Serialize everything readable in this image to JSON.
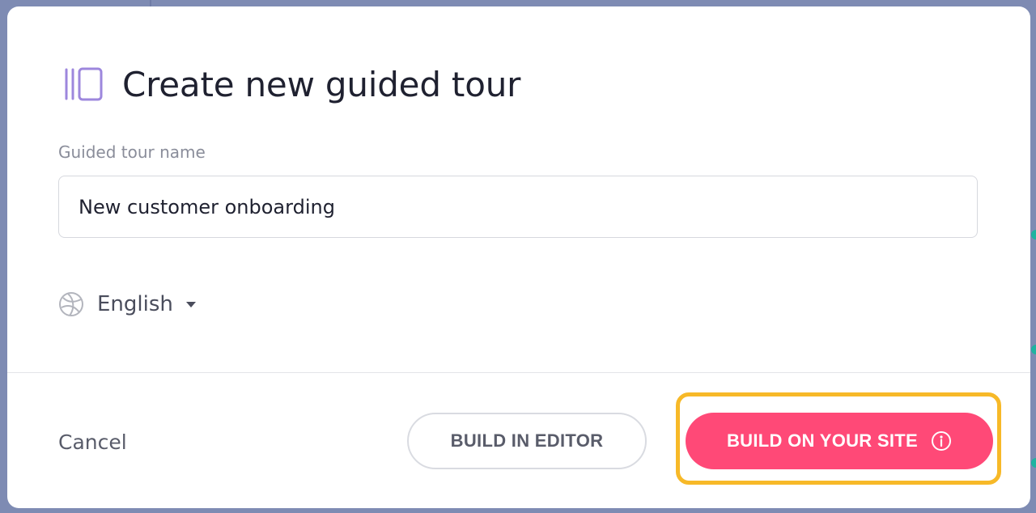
{
  "modal": {
    "title": "Create new guided tour",
    "icon": "guided-tour-icon"
  },
  "form": {
    "name_label": "Guided tour name",
    "name_value": "New customer onboarding",
    "language": "English"
  },
  "footer": {
    "cancel_label": "Cancel",
    "build_editor_label": "BUILD IN EDITOR",
    "build_site_label": "BUILD ON YOUR SITE"
  },
  "colors": {
    "accent_icon": "#9d87dd",
    "primary_button": "#ff4977",
    "highlight": "#f7b928"
  }
}
